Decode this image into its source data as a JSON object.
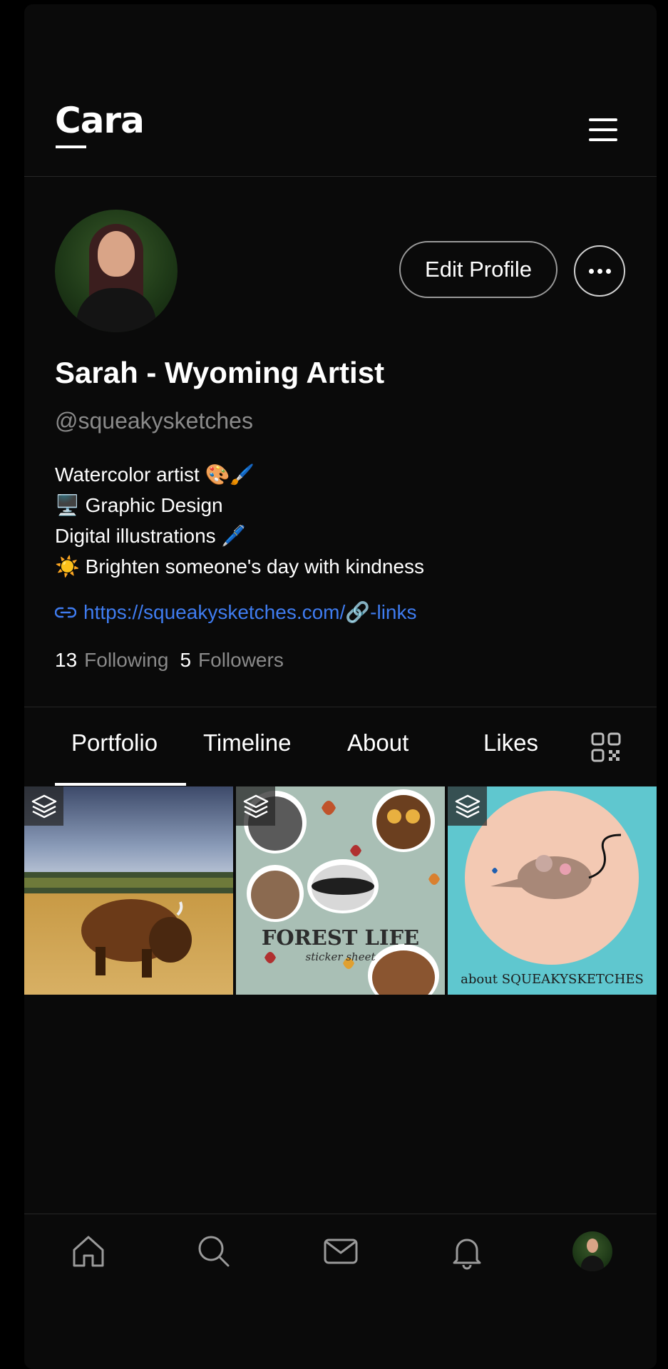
{
  "header": {
    "logo": "Cara"
  },
  "profile": {
    "name": "Sarah - Wyoming Artist",
    "handle": "@squeakysketches",
    "edit_label": "Edit Profile",
    "bio": [
      "Watercolor artist 🎨🖌️",
      "🖥️ Graphic Design",
      "Digital illustrations 🖊️",
      "☀️ Brighten someone's day with kindness"
    ],
    "link": "https://squeakysketches.com/🔗-links",
    "following_count": "13",
    "following_label": "Following",
    "followers_count": "5",
    "followers_label": "Followers"
  },
  "tabs": [
    {
      "label": "Portfolio",
      "active": true
    },
    {
      "label": "Timeline",
      "active": false
    },
    {
      "label": "About",
      "active": false
    },
    {
      "label": "Likes",
      "active": false
    }
  ],
  "portfolio": [
    {
      "title": "",
      "caption": ""
    },
    {
      "title": "FOREST LIFE",
      "caption": "sticker sheet"
    },
    {
      "title": "",
      "caption": "about SQUEAKYSKETCHES"
    }
  ],
  "colors": {
    "background": "#0a0a0a",
    "link": "#3f7cf0",
    "muted": "#8a8a8a"
  },
  "nav": [
    "home-icon",
    "search-icon",
    "mail-icon",
    "bell-icon",
    "profile-avatar"
  ]
}
